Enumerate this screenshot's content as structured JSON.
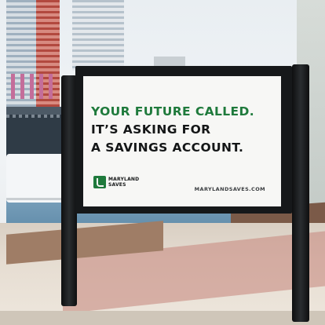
{
  "billboard": {
    "headline_line1": "YOUR FUTURE CALLED.",
    "headline_line2": "IT’S ASKING FOR",
    "headline_line3": "A SAVINGS ACCOUNT.",
    "logo_line1": "MARYLAND",
    "logo_line2": "SAVES",
    "url": "MARYLANDSAVES.COM",
    "colors": {
      "accent_green": "#1f7a3c",
      "text_dark": "#141617",
      "frame": "#16181a",
      "panel": "#f7f7f5"
    }
  }
}
